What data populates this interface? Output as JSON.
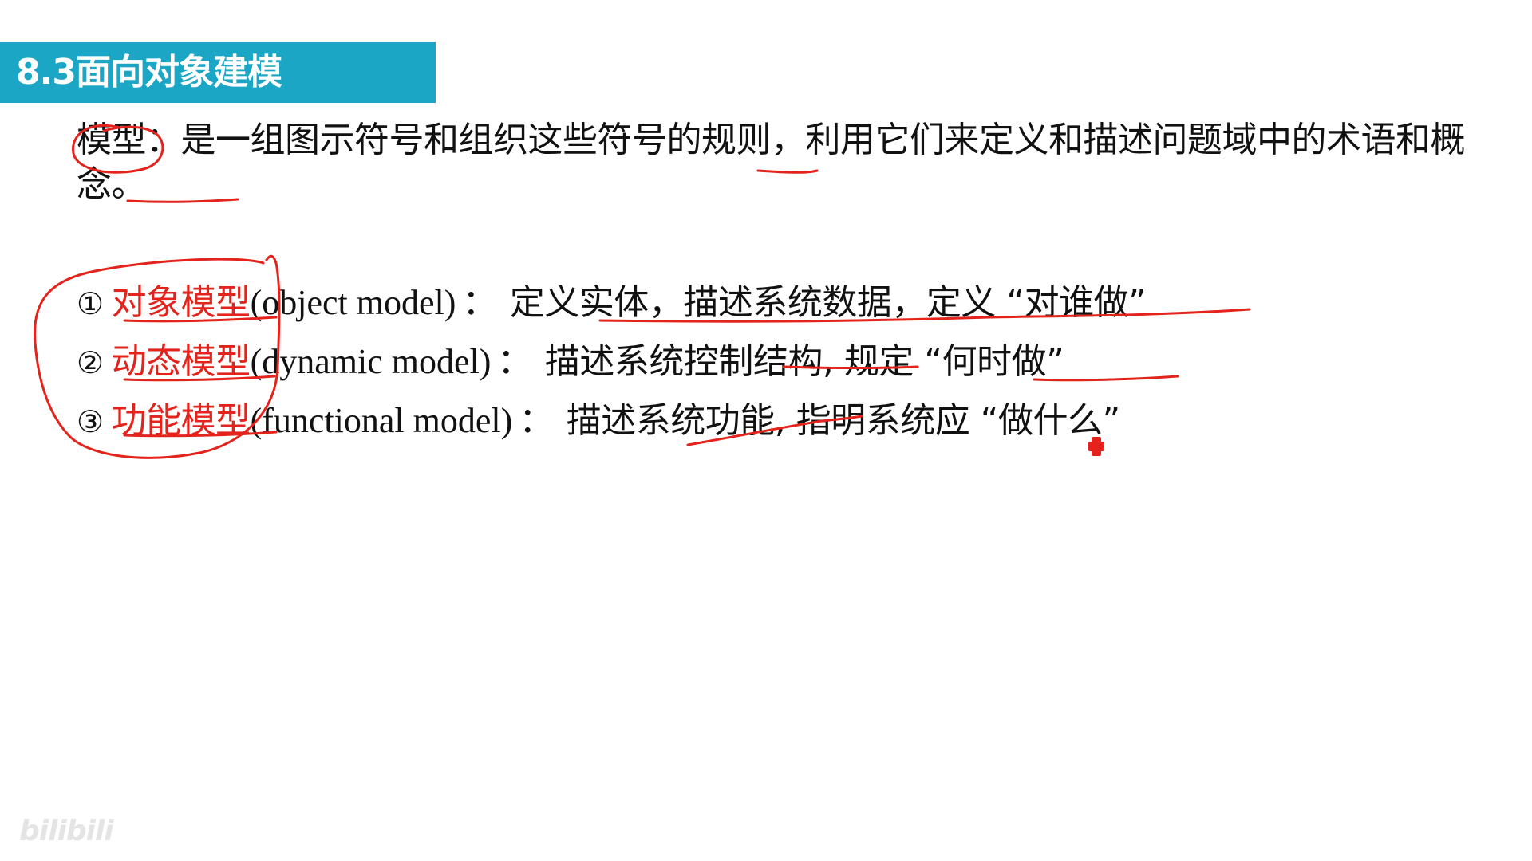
{
  "slide": {
    "title": "8.3面向对象建模",
    "definition": {
      "term": "模型",
      "colon": "：",
      "text": "是一组图示符号和组织这些符号的规则，利用它们来定义和描述问题域中的术语和概念。"
    },
    "models": [
      {
        "number": "①",
        "term": "对象模型",
        "english": "(object model)",
        "separator": "：",
        "description": "定义实体，描述系统数据，定义 “对谁做”"
      },
      {
        "number": "②",
        "term": "动态模型",
        "english": "(dynamic model)",
        "separator": "：",
        "description": "描述系统控制结构, 规定 “何时做”"
      },
      {
        "number": "③",
        "term": "功能模型",
        "english": "(functional model)",
        "separator": "：",
        "description": "描述系统功能, 指明系统应 “做什么”"
      }
    ]
  },
  "annotation_color": "#e3231c",
  "banner_color": "#1aa6c4",
  "watermark": "bilibili"
}
